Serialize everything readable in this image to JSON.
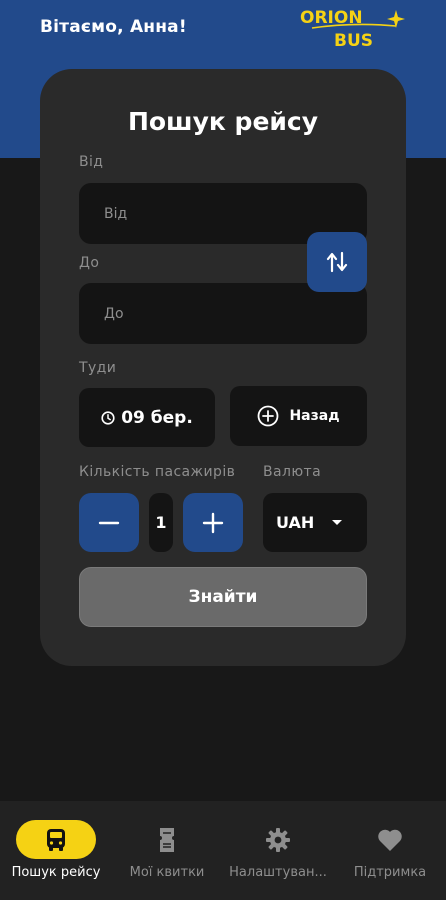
{
  "header": {
    "greeting": "Вітаємо, Анна!",
    "logo_line1": "ORION",
    "logo_line2": "BUS"
  },
  "search": {
    "title": "Пошук рейсу",
    "from_label": "Від",
    "from_placeholder": "Від",
    "to_label": "До",
    "to_placeholder": "До",
    "depart_label": "Туди",
    "depart_date": "09 бер.",
    "return_button": "Назад",
    "passengers_label": "Кількість пасажирів",
    "passengers_count": "1",
    "currency_label": "Валюта",
    "currency_value": "UAH",
    "submit_button": "Знайти"
  },
  "nav": {
    "items": [
      {
        "label": "Пошук рейсу",
        "icon": "bus-icon",
        "active": true
      },
      {
        "label": "Мої квитки",
        "icon": "tickets-icon",
        "active": false
      },
      {
        "label": "Налаштуван...",
        "icon": "gear-icon",
        "active": false
      },
      {
        "label": "Підтримка",
        "icon": "heart-icon",
        "active": false
      }
    ]
  },
  "colors": {
    "brand_blue": "#224a8b",
    "accent_yellow": "#f5d214",
    "background": "#181818",
    "card": "#2a2a2a",
    "field": "#141414"
  }
}
